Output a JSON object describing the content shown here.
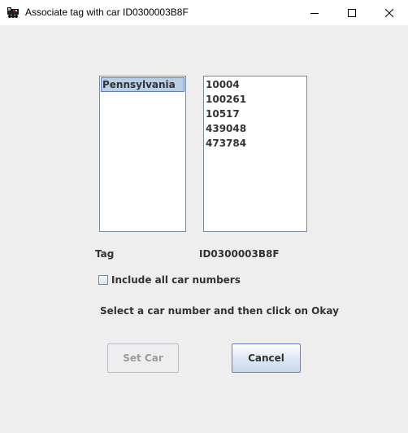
{
  "window": {
    "title": "Associate tag with car ID0300003B8F",
    "icon": "train-engine-icon"
  },
  "state_list": {
    "items": [
      "Pennsylvania"
    ],
    "selected": "Pennsylvania"
  },
  "car_list": {
    "items": [
      "10004",
      "100261",
      "10517",
      "439048",
      "473784"
    ]
  },
  "tag": {
    "label": "Tag",
    "value": "ID0300003B8F"
  },
  "include_all": {
    "label": "Include all car numbers",
    "checked": false
  },
  "instructions": "Select a car number and then click on Okay",
  "buttons": {
    "set_car": "Set Car",
    "cancel": "Cancel"
  },
  "colors": {
    "selection": "#b8cfe5",
    "selection_border": "#6382bf",
    "background": "#eeeeee"
  }
}
